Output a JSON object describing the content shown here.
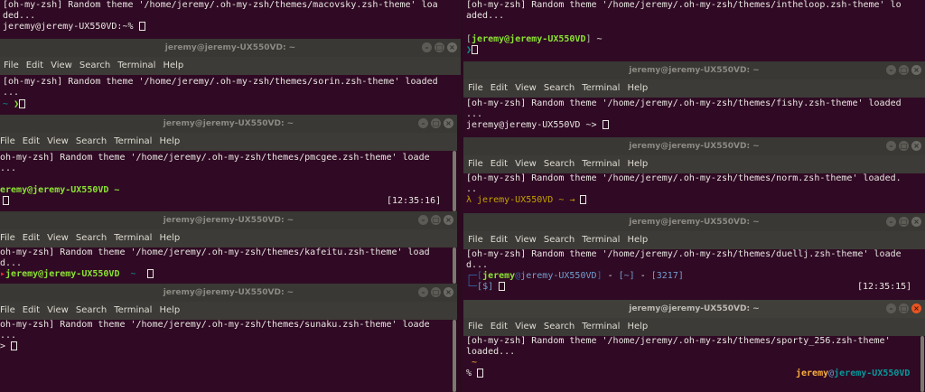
{
  "menu": [
    "File",
    "Edit",
    "View",
    "Search",
    "Terminal",
    "Help"
  ],
  "window_title": "jeremy@jeremy-UX550VD: ~",
  "term_top_left": {
    "line1": "[oh-my-zsh] Random theme '/home/jeremy/.oh-my-zsh/themes/macovsky.zsh-theme' loa",
    "line2": "ded...",
    "prompt": "jeremy@jeremy-UX550VD:~%"
  },
  "term_top_right": {
    "line1": "[oh-my-zsh] Random theme '/home/jeremy/.oh-my-zsh/themes/intheloop.zsh-theme' lo",
    "line2": "aded...",
    "prompt_user": "jeremy@jeremy-UX550VD",
    "prompt_dir": "~",
    "prompt_arrow": "❯"
  },
  "term_sorin": {
    "line1": "[oh-my-zsh] Random theme '/home/jeremy/.oh-my-zsh/themes/sorin.zsh-theme' loaded",
    "line2": "...",
    "prompt_dir": "~",
    "prompt_arrow": "❯"
  },
  "term_pmcgee": {
    "line1": "oh-my-zsh] Random theme '/home/jeremy/.oh-my-zsh/themes/pmcgee.zsh-theme' loade",
    "line2": "...",
    "prompt": "eremy@jeremy-UX550VD ~",
    "time": "[12:35:16]"
  },
  "term_kafeitu": {
    "line1": "oh-my-zsh] Random theme '/home/jeremy/.oh-my-zsh/themes/kafeitu.zsh-theme' load",
    "line2": "d...",
    "prompt_user": "jeremy@jeremy-UX550VD",
    "prompt_dir": "~"
  },
  "term_sunaku": {
    "line1": "oh-my-zsh] Random theme '/home/jeremy/.oh-my-zsh/themes/sunaku.zsh-theme' loade",
    "line2": "...",
    "prompt": ">"
  },
  "term_fishy": {
    "line1": "[oh-my-zsh] Random theme '/home/jeremy/.oh-my-zsh/themes/fishy.zsh-theme' loaded",
    "line2": "...",
    "prompt": "jeremy@jeremy-UX550VD ~>"
  },
  "term_norm": {
    "line1": "[oh-my-zsh] Random theme '/home/jeremy/.oh-my-zsh/themes/norm.zsh-theme' loaded.",
    "line2": "..",
    "prompt": "λ jeremy-UX550VD ~ →"
  },
  "term_duellj": {
    "line1": "[oh-my-zsh] Random theme '/home/jeremy/.oh-my-zsh/themes/duellj.zsh-theme' loade",
    "line2": "d...",
    "prompt_user": "jeremy",
    "prompt_at": "@",
    "prompt_host": "jeremy-UX550VD",
    "prompt_dir": "[~]",
    "prompt_num": "[3217]",
    "prompt2": "[$]",
    "time": "[12:35:15]"
  },
  "term_sporty": {
    "line1": "[oh-my-zsh] Random theme '/home/jeremy/.oh-my-zsh/themes/sporty_256.zsh-theme'",
    "line2": "loaded...",
    "tilde": "~",
    "prompt": "%",
    "right_user": "jeremy",
    "right_at": "@",
    "right_host": "jeremy-UX550VD"
  }
}
